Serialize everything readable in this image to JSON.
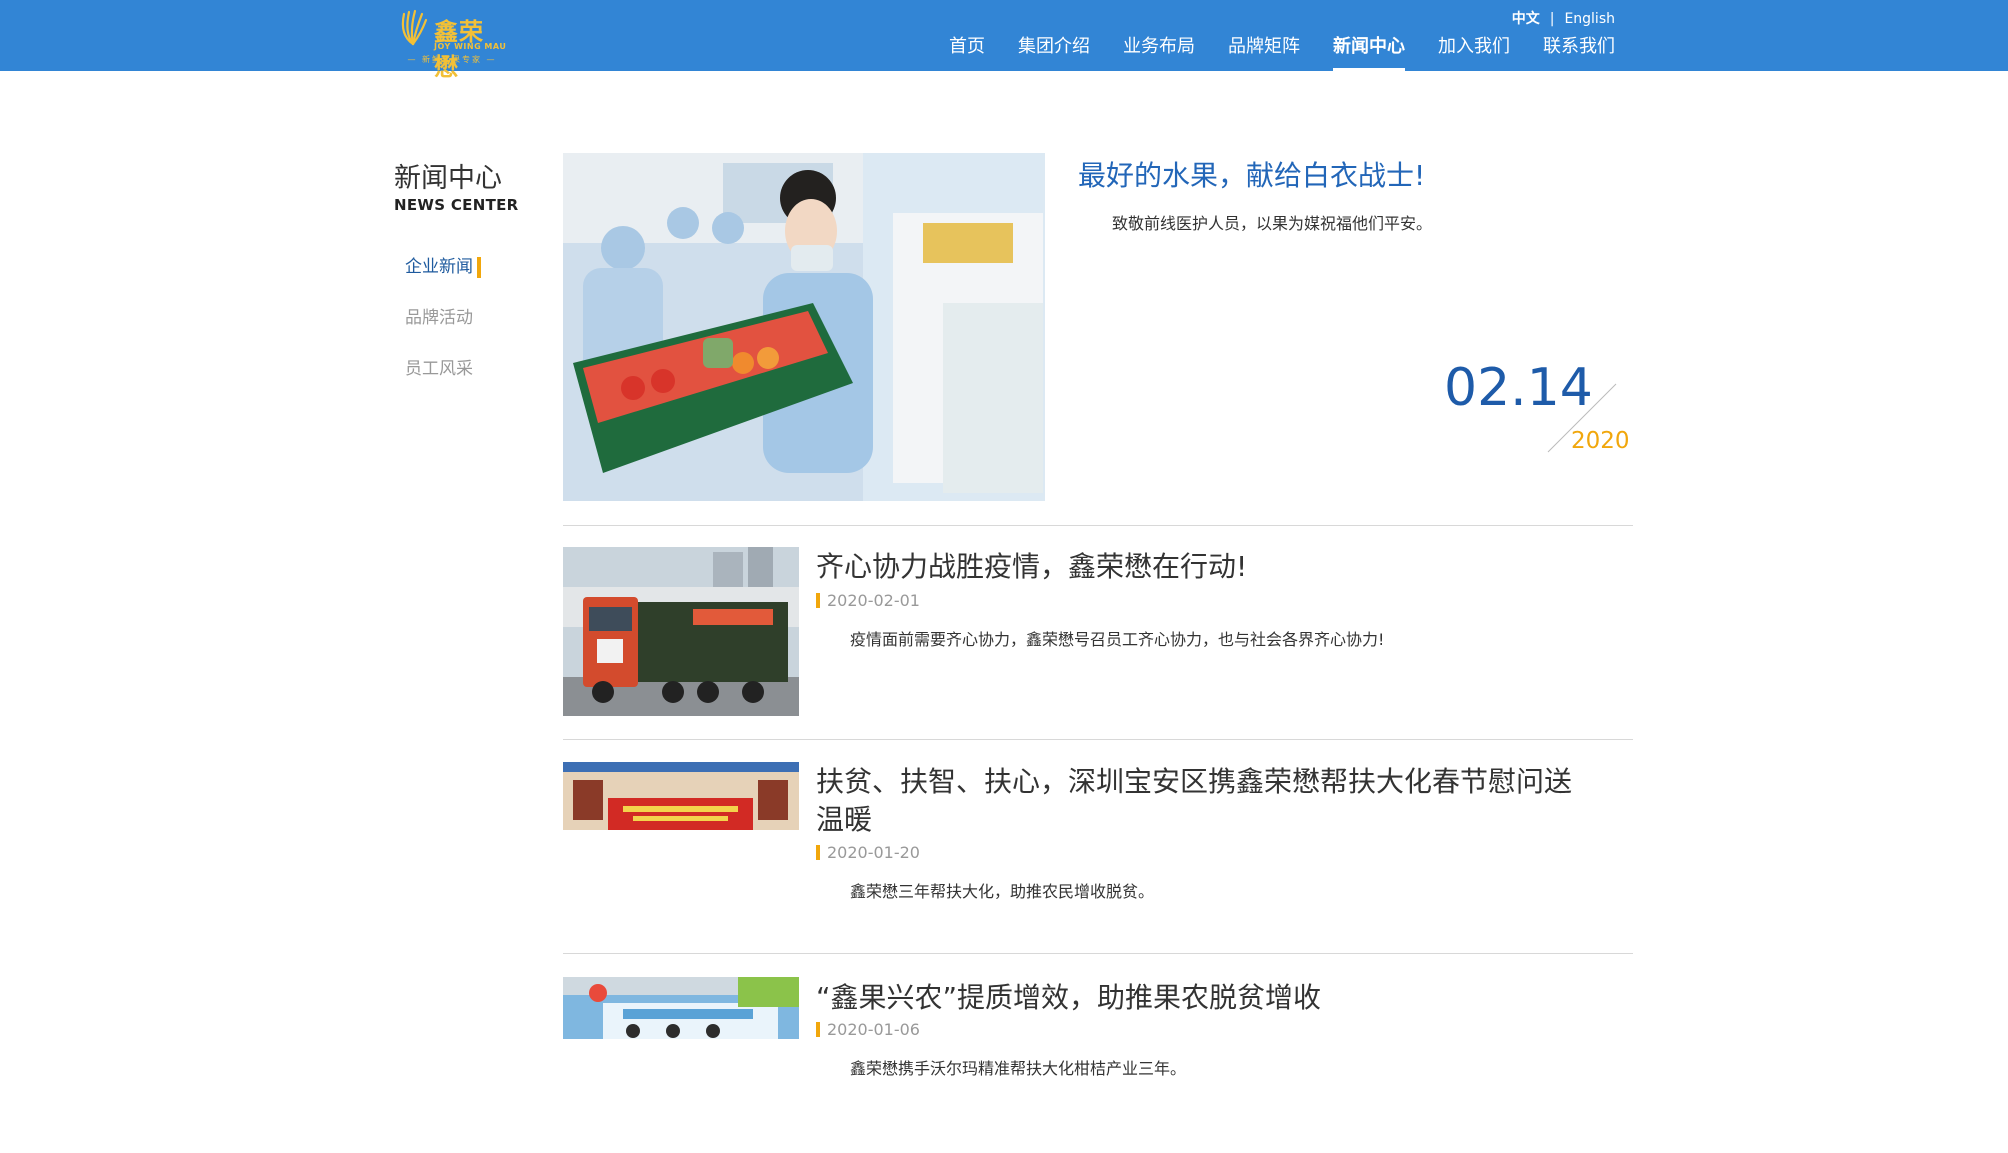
{
  "brand": {
    "logo_cn": "鑫荣懋",
    "logo_en": "JOY WING MAU",
    "slogan": "新鲜水果专家",
    "logo_color": "#f2c037",
    "header_color": "#3285d5"
  },
  "lang": {
    "current": "中文",
    "other": "English"
  },
  "nav": [
    {
      "label": "首页"
    },
    {
      "label": "集团介绍"
    },
    {
      "label": "业务布局"
    },
    {
      "label": "品牌矩阵"
    },
    {
      "label": "新闻中心",
      "active": true
    },
    {
      "label": "加入我们"
    },
    {
      "label": "联系我们"
    }
  ],
  "sidebar": {
    "title": "新闻中心",
    "subtitle": "NEWS CENTER",
    "items": [
      {
        "label": "企业新闻",
        "active": true
      },
      {
        "label": "品牌活动"
      },
      {
        "label": "员工风采"
      }
    ]
  },
  "featured": {
    "title": "最好的水果，献给白衣战士!",
    "summary": "致敬前线医护人员，以果为媒祝福他们平安。",
    "date_md": "02.14",
    "year": "2020"
  },
  "news": [
    {
      "title": "齐心协力战胜疫情，鑫荣懋在行动!",
      "date": "2020-02-01",
      "summary": "疫情面前需要齐心协力，鑫荣懋号召员工齐心协力，也与社会各界齐心协力!"
    },
    {
      "title": "扶贫、扶智、扶心，深圳宝安区携鑫荣懋帮扶大化春节慰问送温暖",
      "date": "2020-01-20",
      "summary": "鑫荣懋三年帮扶大化，助推农民增收脱贫。"
    },
    {
      "title": "“鑫果兴农”提质增效，助推果农脱贫增收",
      "date": "2020-01-06",
      "summary": "鑫荣懋携手沃尔玛精准帮扶大化柑桔产业三年。"
    }
  ],
  "colors": {
    "accent_blue": "#2266b8",
    "accent_orange": "#f1a70c"
  }
}
